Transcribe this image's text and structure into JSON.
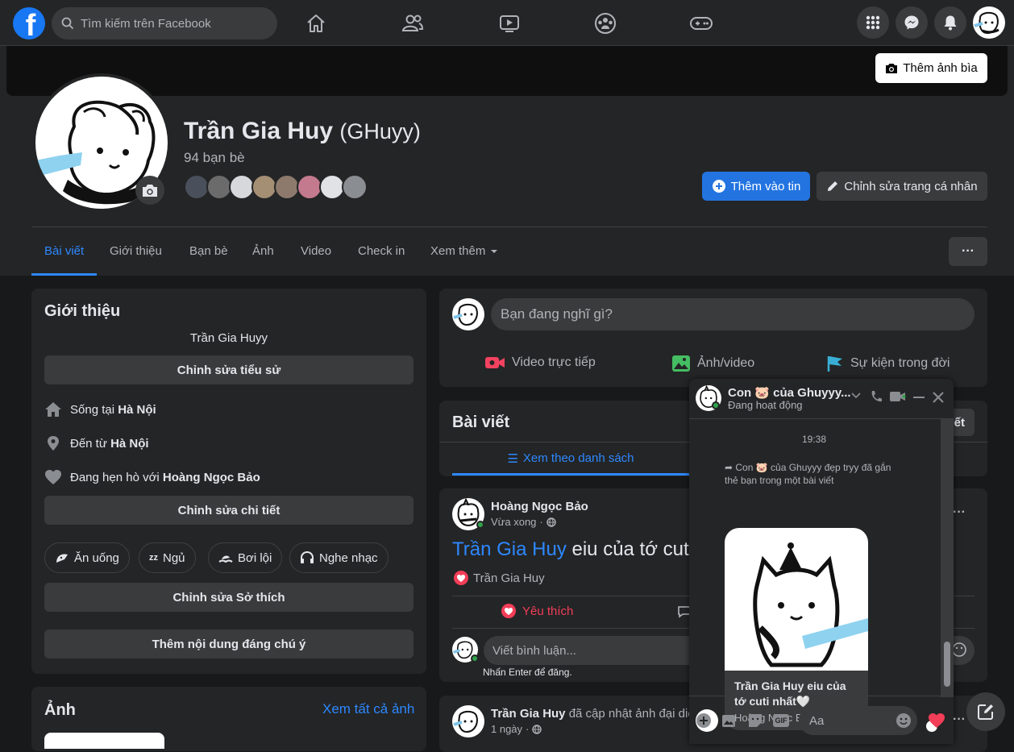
{
  "topbar": {
    "logo": "f",
    "search_placeholder": "Tìm kiếm trên Facebook",
    "nav_icons": [
      "home-icon",
      "friends-icon",
      "watch-icon",
      "groups-icon",
      "gaming-icon"
    ],
    "right_icons": [
      "menu-grid-icon",
      "messenger-icon",
      "bell-icon",
      "profile-avatar"
    ]
  },
  "profile": {
    "add_cover_label": "Thêm ảnh bìa",
    "name": "Trần Gia Huy",
    "alt_name": "(GHuyy)",
    "friends_count": "94 bạn bè",
    "add_story_label": "Thêm vào tin",
    "edit_profile_label": "Chỉnh sửa trang cá nhân",
    "more_label": "···"
  },
  "tabs": [
    {
      "label": "Bài viết",
      "active": true
    },
    {
      "label": "Giới thiệu"
    },
    {
      "label": "Bạn bè"
    },
    {
      "label": "Ảnh"
    },
    {
      "label": "Video"
    },
    {
      "label": "Check in"
    },
    {
      "label": "Xem thêm"
    }
  ],
  "intro": {
    "title": "Giới thiệu",
    "bio": "Trần Gia Huyy",
    "edit_bio_label": "Chỉnh sửa tiểu sử",
    "lives_prefix": "Sống tại ",
    "lives_place": "Hà Nội",
    "from_prefix": "Đến từ ",
    "from_place": "Hà Nội",
    "dating_prefix": "Đang hẹn hò với ",
    "dating_person": "Hoàng Ngọc Bảo",
    "edit_details_label": "Chỉnh sửa chi tiết",
    "hobbies": [
      "Ăn uống",
      "Ngủ",
      "Bơi lội",
      "Nghe nhạc"
    ],
    "edit_hobbies_label": "Chỉnh sửa Sở thích",
    "add_featured_label": "Thêm nội dung đáng chú ý"
  },
  "photos": {
    "title": "Ảnh",
    "see_all_label": "Xem tất cả ảnh"
  },
  "composer": {
    "placeholder": "Bạn đang nghĩ gì?",
    "live_label": "Video trực tiếp",
    "photo_label": "Ảnh/video",
    "event_label": "Sự kiện trong đời"
  },
  "posts_header": {
    "title": "Bài viết",
    "filter_partial": "ết",
    "list_view_label": "Xem theo danh sách"
  },
  "post1": {
    "author": "Hoàng Ngọc Bảo",
    "time": "Vừa xong",
    "tagged": "Trần Gia Huy",
    "text": " eiu của tớ cuti",
    "reactor": "Trần Gia Huy",
    "like_label": "Yêu thích",
    "comment_placeholder": "Viết bình luận...",
    "enter_hint": "Nhấn Enter để đăng."
  },
  "post2": {
    "author": "Trần Gia Huy",
    "action": " đã cập nhật ảnh đại diệ",
    "time": "1 ngày"
  },
  "chat": {
    "name": "Con 🐷 của Ghuyyy...",
    "status": "Đang hoạt động",
    "time": "19:38",
    "tag_notice": "Con 🐷 của Ghuyyy đẹp tryy đã gắn thẻ bạn trong một bài viết",
    "card_text": "Trần Gia Huy eiu của tớ cuti nhất🤍",
    "card_author": "Hoàng Ngọc Bảo",
    "input_placeholder": "Aa"
  },
  "colors": {
    "bg": "#18191a",
    "card": "#242526",
    "accent": "#2d88ff",
    "button": "#3a3b3c",
    "online": "#31a24c",
    "like": "#f33e58"
  }
}
